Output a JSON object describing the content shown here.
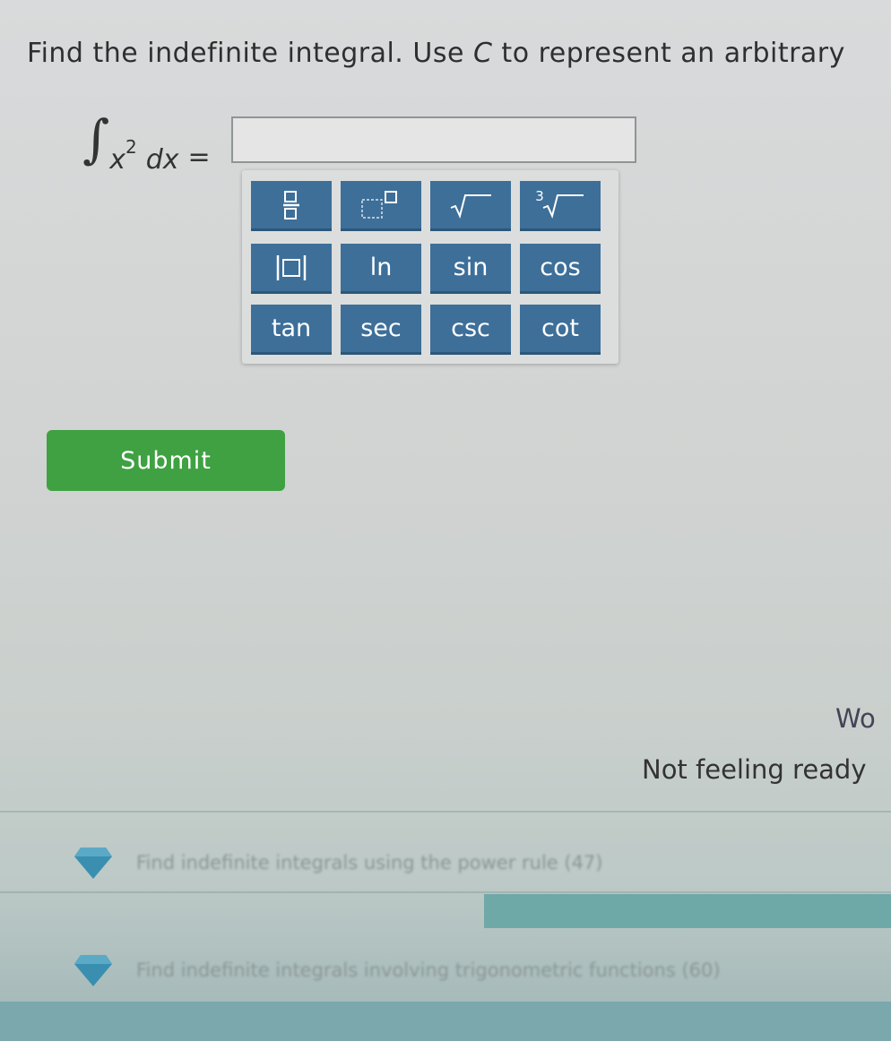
{
  "question": {
    "prefix": "Find the indefinite integral. Use ",
    "c_var": "C",
    "suffix": " to represent an arbitrary"
  },
  "integral": {
    "sign": "∫",
    "base": "x",
    "exponent": "2",
    "dx": "dx",
    "equals": "="
  },
  "answer": {
    "value": ""
  },
  "keypad": {
    "keys": [
      {
        "label": "",
        "icon": "fraction-icon"
      },
      {
        "label": "",
        "icon": "exponent-icon"
      },
      {
        "label": "",
        "icon": "square-root-icon"
      },
      {
        "label": "3",
        "icon": "cube-root-icon"
      },
      {
        "label": "",
        "icon": "absolute-value-icon"
      },
      {
        "label": "ln"
      },
      {
        "label": "sin"
      },
      {
        "label": "cos"
      },
      {
        "label": "tan"
      },
      {
        "label": "sec"
      },
      {
        "label": "csc"
      },
      {
        "label": "cot"
      }
    ]
  },
  "submit_label": "Submit",
  "side_heading": "Wo",
  "not_ready": "Not feeling ready",
  "skills": [
    {
      "text": "Find indefinite integrals using the power rule (47)",
      "icon": "gem-icon"
    },
    {
      "text": "Find indefinite integrals involving trigonometric functions (60)",
      "icon": "gem-icon"
    }
  ],
  "colors": {
    "key_bg": "#3d6f99",
    "submit_bg": "#3fa142",
    "gem": "#3a8fb0"
  }
}
